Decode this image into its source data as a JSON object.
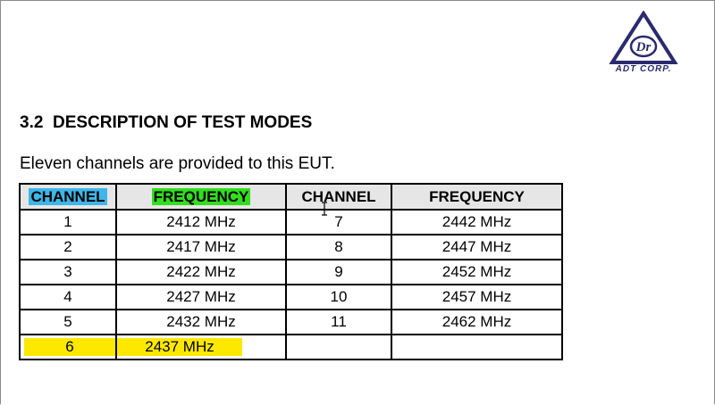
{
  "logo": {
    "text": "ADT CORP.",
    "letters": "ADr"
  },
  "heading": "3.2  DESCRIPTION OF TEST MODES",
  "intro": "Eleven channels are provided to this EUT.",
  "table": {
    "headers": [
      "CHANNEL",
      "FREQUENCY",
      "CHANNEL",
      "FREQUENCY"
    ],
    "rows": [
      [
        "1",
        "2412 MHz",
        "7",
        "2442 MHz"
      ],
      [
        "2",
        "2417 MHz",
        "8",
        "2447 MHz"
      ],
      [
        "3",
        "2422 MHz",
        "9",
        "2452 MHz"
      ],
      [
        "4",
        "2427 MHz",
        "10",
        "2457 MHz"
      ],
      [
        "5",
        "2432 MHz",
        "11",
        "2462 MHz"
      ],
      [
        "6",
        "2437 MHz",
        "",
        ""
      ]
    ]
  },
  "highlight_colors": {
    "blue": "#3fb6e8",
    "green": "#33dd1f",
    "yellow": "#ffe800"
  },
  "cursor_icon": "text-cursor-icon"
}
